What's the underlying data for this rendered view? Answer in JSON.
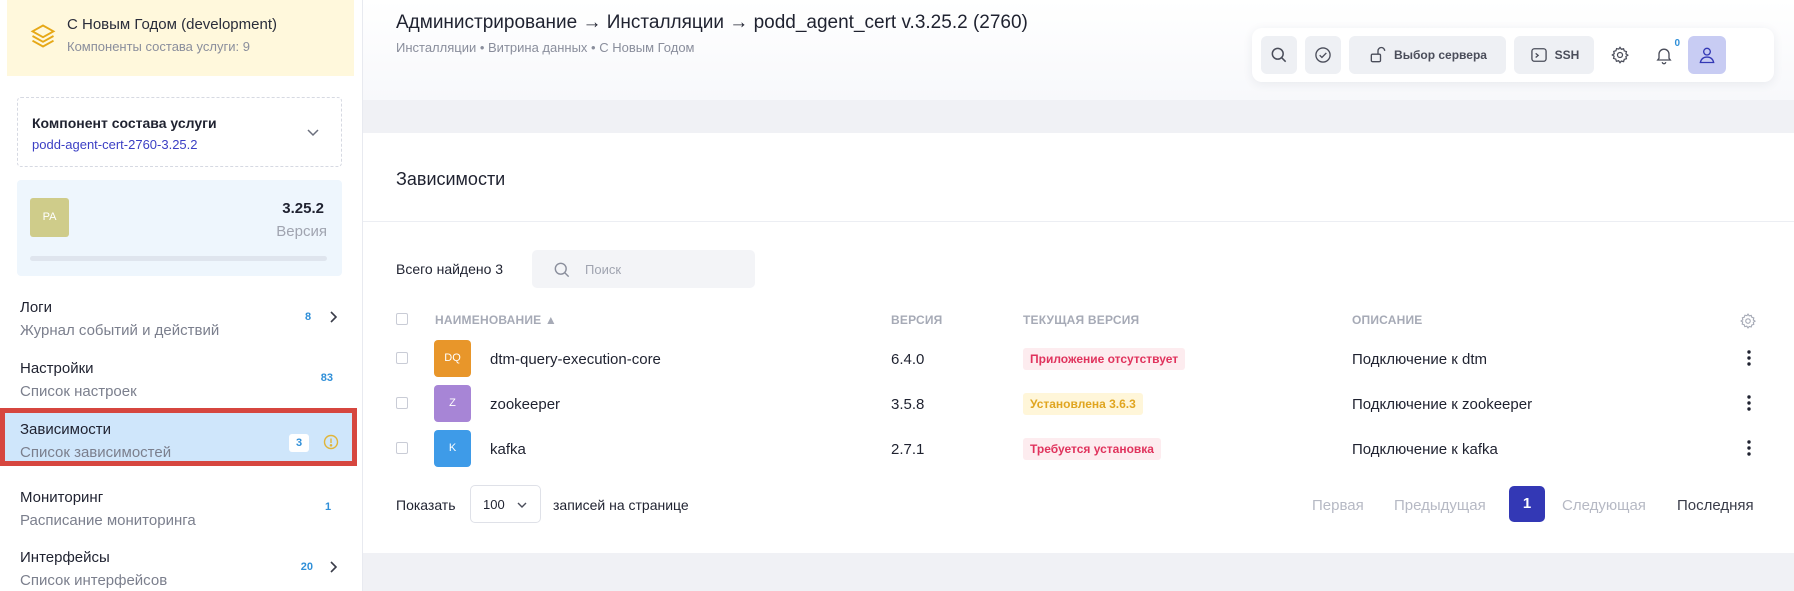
{
  "sidebar": {
    "service": {
      "title": "С Новым Годом (development)",
      "subtitle": "Компоненты состава услуги: 9",
      "icon": "layers-icon"
    },
    "component": {
      "label": "Компонент состава услуги",
      "value": "podd-agent-cert-2760-3.25.2"
    },
    "version": {
      "avatar": "PA",
      "number": "3.25.2",
      "label": "Версия"
    },
    "items": [
      {
        "title": "Логи",
        "subtitle": "Журнал событий и действий",
        "count": "8",
        "arrow": true
      },
      {
        "title": "Настройки",
        "subtitle": "Список настроек",
        "count": "83",
        "arrow": false
      },
      {
        "title": "Зависимости",
        "subtitle": "Список зависимостей",
        "count": "3",
        "active": true,
        "warn": true
      },
      {
        "title": "Мониторинг",
        "subtitle": "Расписание мониторинга",
        "count": "1",
        "arrow": false
      },
      {
        "title": "Интерфейсы",
        "subtitle": "Список интерфейсов",
        "count": "20",
        "arrow": true
      }
    ]
  },
  "header": {
    "title": "Администрирование → Инсталляции → podd_agent_cert v.3.25.2 (2760)",
    "crumbs": "Инсталляции  •  Витрина данных  •  С Новым Годом",
    "toolbar": {
      "server_label": "Выбор сервера",
      "ssh_label": "SSH",
      "notif_count": "0"
    }
  },
  "main": {
    "title": "Зависимости",
    "found": "Всего найдено 3",
    "search_placeholder": "Поиск",
    "columns": {
      "name": "НАИМЕНОВАНИЕ ▲",
      "version": "ВЕРСИЯ",
      "current": "ТЕКУЩАЯ ВЕРСИЯ",
      "desc": "ОПИСАНИЕ"
    },
    "rows": [
      {
        "avatar": "DQ",
        "avatar_color": "#e8962a",
        "name": "dtm-query-execution-core",
        "version": "6.4.0",
        "status": "Приложение отсутствует",
        "status_kind": "red",
        "desc": "Подключение к dtm"
      },
      {
        "avatar": "Z",
        "avatar_color": "#a785d6",
        "name": "zookeeper",
        "version": "3.5.8",
        "status": "Установлена 3.6.3",
        "status_kind": "yel",
        "desc": "Подключение к zookeeper"
      },
      {
        "avatar": "K",
        "avatar_color": "#3e9be8",
        "name": "kafka",
        "version": "2.7.1",
        "status": "Требуется установка",
        "status_kind": "red",
        "desc": "Подключение к kafka"
      }
    ],
    "pager": {
      "show": "Показать",
      "per_page": "100",
      "per_page_suffix": "записей на странице",
      "first": "Первая",
      "prev": "Предыдущая",
      "current": "1",
      "next": "Следующая",
      "last": "Последняя"
    }
  }
}
